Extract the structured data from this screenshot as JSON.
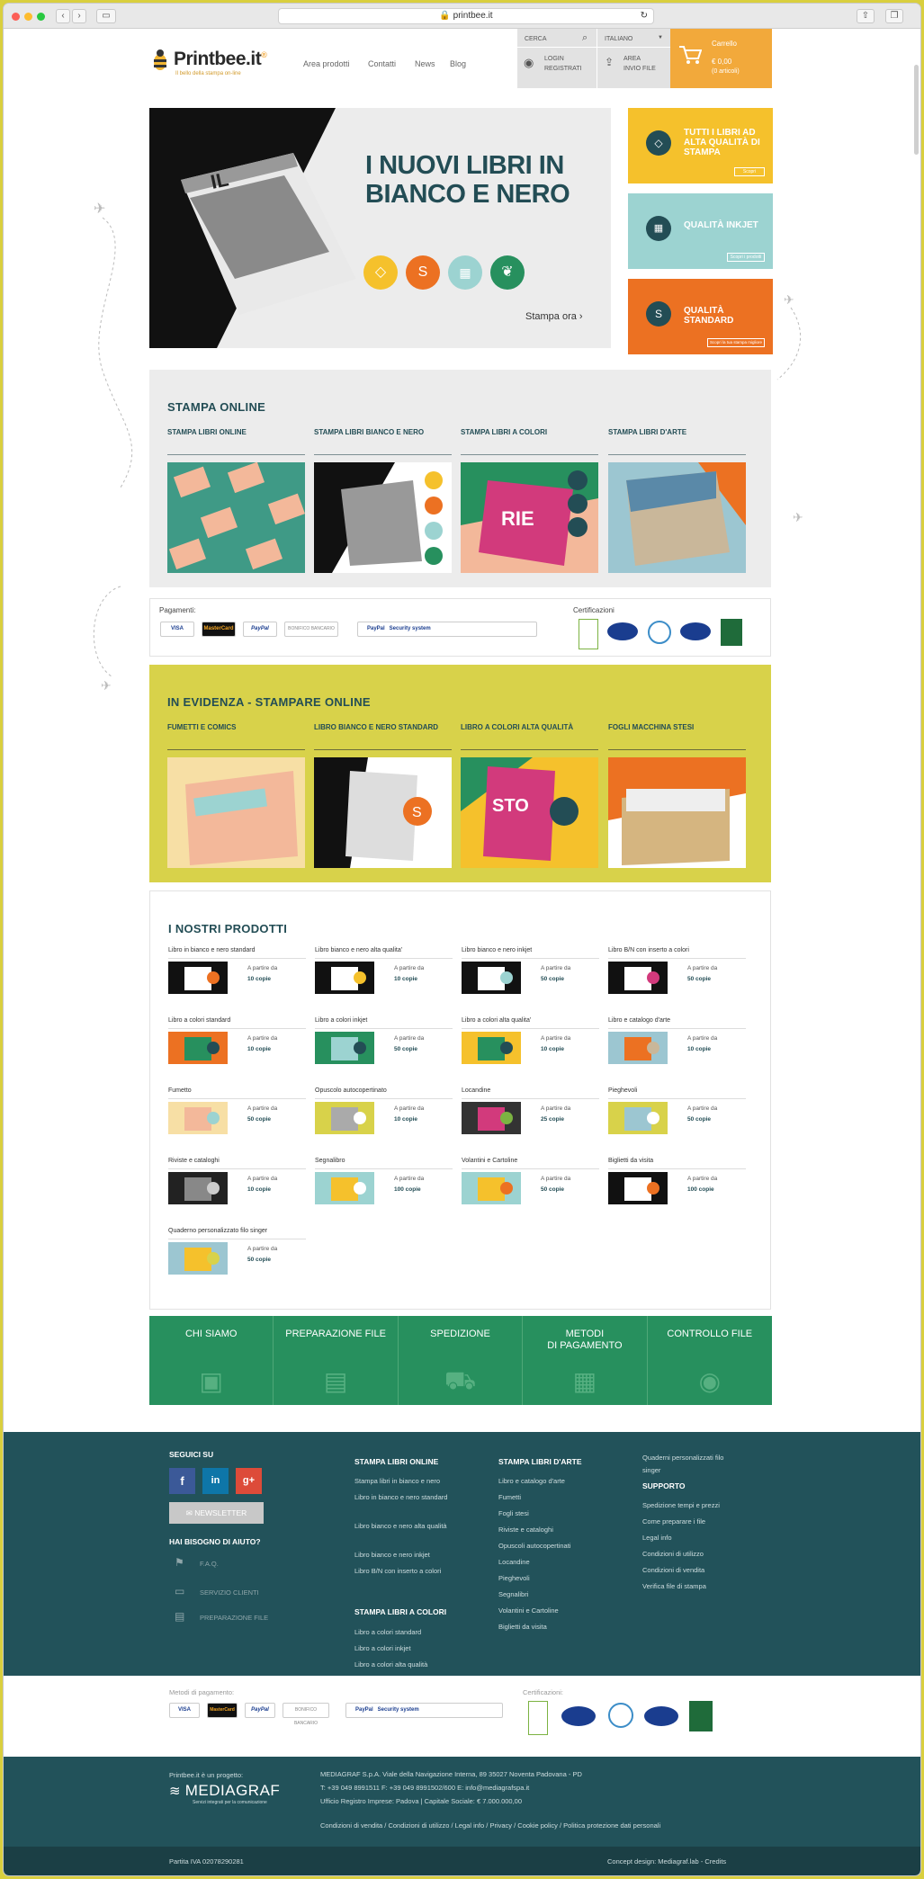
{
  "browser": {
    "url": "printbee.it"
  },
  "header": {
    "logo": "Printbee.it",
    "logo_reg": "®",
    "tagline": "Il bello della stampa on-line",
    "nav": [
      "Area prodotti",
      "Contatti",
      "News",
      "Blog"
    ],
    "search_label": "CERCA",
    "language": "ITALIANO",
    "login": "LOGIN\nREGISTRATI",
    "upload": "AREA\nINVIO FILE",
    "cart_title": "Carrello",
    "cart_amount": "€ 0,00",
    "cart_items": "(0 articoli)"
  },
  "hero": {
    "title": "I NUOVI LIBRI IN BIANCO E NERO",
    "cta": "Stampa ora ›",
    "icons": [
      "diamond-icon",
      "coin-icon",
      "inkjet-icon",
      "leaf-icon"
    ],
    "book_cover_text": "IL ... STORIE"
  },
  "categories": [
    {
      "title": "TUTTI I LIBRI AD ALTA QUALITÀ DI STAMPA",
      "button": "Scopri",
      "color": "#f5c12c"
    },
    {
      "title": "QUALITÀ INKJET",
      "button": "Scopri i prodotti",
      "color": "#9cd3d1"
    },
    {
      "title": "QUALITÀ STANDARD",
      "button": "Scopri la tua stampa migliore",
      "color": "#ec7122"
    }
  ],
  "stampa_online": {
    "title": "STAMPA ONLINE",
    "columns": [
      "STAMPA LIBRI ONLINE",
      "STAMPA LIBRI BIANCO E NERO",
      "STAMPA LIBRI A COLORI",
      "STAMPA LIBRI D'ARTE"
    ]
  },
  "payments": {
    "label": "Pagamenti:",
    "methods": [
      "VISA",
      "MasterCard",
      "PayPal",
      "BONIFICO BANCARIO"
    ],
    "paypal_security": "PayPal   Security system",
    "cert_label": "Certificazioni"
  },
  "evidenza": {
    "title": "IN EVIDENZA - STAMPARE ONLINE",
    "columns": [
      "FUMETTI E COMICS",
      "LIBRO BIANCO E NERO STANDARD",
      "LIBRO A COLORI ALTA QUALITÀ",
      "FOGLI MACCHINA STESI"
    ]
  },
  "prodotti": {
    "title": "I NOSTRI PRODOTTI",
    "from_label": "A partire da",
    "items": [
      {
        "name": "Libro in bianco e nero standard",
        "qty": "10 copie"
      },
      {
        "name": "Libro bianco e nero alta qualita'",
        "qty": "10 copie"
      },
      {
        "name": "Libro bianco e nero inkjet",
        "qty": "50 copie"
      },
      {
        "name": "Libro B/N con inserto a colori",
        "qty": "50 copie"
      },
      {
        "name": "Libro a colori standard",
        "qty": "10 copie"
      },
      {
        "name": "Libro a colori inkjet",
        "qty": "50 copie"
      },
      {
        "name": "Libro a colori alta qualita'",
        "qty": "10 copie"
      },
      {
        "name": "Libro e catalogo d'arte",
        "qty": "10 copie"
      },
      {
        "name": "Fumetto",
        "qty": "50 copie"
      },
      {
        "name": "Opuscolo autocopertinato",
        "qty": "10 copie"
      },
      {
        "name": "Locandine",
        "qty": "25 copie"
      },
      {
        "name": "Pieghevoli",
        "qty": "50 copie"
      },
      {
        "name": "Riviste e cataloghi",
        "qty": "10 copie"
      },
      {
        "name": "Segnalibro",
        "qty": "100 copie"
      },
      {
        "name": "Volantini e Cartoline",
        "qty": "50 copie"
      },
      {
        "name": "Biglietti da visita",
        "qty": "100 copie"
      },
      {
        "name": "Quaderno personalizzato filo singer",
        "qty": "50 copie"
      }
    ]
  },
  "info_bar": [
    {
      "label": "CHI SIAMO",
      "icon": "badge-icon"
    },
    {
      "label": "PREPARAZIONE FILE",
      "icon": "id-card-icon"
    },
    {
      "label": "SPEDIZIONE",
      "icon": "hand-truck-icon"
    },
    {
      "label": "METODI\nDI PAGAMENTO",
      "icon": "cash-icon"
    },
    {
      "label": "CONTROLLO FILE",
      "icon": "eye-icon"
    }
  ],
  "footer": {
    "follow": "SEGUICI SU",
    "social": [
      "f",
      "in",
      "g+"
    ],
    "newsletter": "NEWSLETTER",
    "help_title": "HAI BISOGNO DI AIUTO?",
    "help_items": [
      "F.A.Q.",
      "SERVIZIO CLIENTI",
      "PREPARAZIONE FILE"
    ],
    "col1_title": "STAMPA LIBRI ONLINE",
    "col1": [
      "Stampa libri in bianco e nero",
      "Libro in bianco e nero standard",
      "Libro bianco e nero alta qualità",
      "Libro bianco e nero inkjet",
      "Libro B/N con inserto a colori"
    ],
    "col1b_title": "STAMPA LIBRI A COLORI",
    "col1b": [
      "Libro a colori standard",
      "Libro a colori inkjet",
      "Libro a colori alta qualità"
    ],
    "col2_title": "STAMPA LIBRI D'ARTE",
    "col2": [
      "Libro e catalogo d'arte",
      "Fumetti",
      "Fogli stesi",
      "Riviste e cataloghi",
      "Opuscoli autocopertinati",
      "Locandine",
      "Pieghevoli",
      "Segnalibri",
      "Volantini e Cartoline",
      "Biglietti da visita"
    ],
    "col3_top": "Quaderni personalizzati filo singer",
    "col3_title": "SUPPORTO",
    "col3": [
      "Spedizione tempi e prezzi",
      "Come preparare i file",
      "Legal info",
      "Condizioni di utilizzo",
      "Condizioni di vendita",
      "Verifica file di stampa"
    ]
  },
  "pay_strip": {
    "label": "Metodi di pagamento:",
    "cert_label": "Certificazioni:"
  },
  "bottom": {
    "project": "Printbee.it è un progetto:",
    "company_logo": "MEDIAGRAF",
    "company_sub": "Servizi integrati per la comunicazione",
    "address": "MEDIAGRAF S.p.A. Viale della Navigazione Interna, 89 35027 Noventa Padovana - PD",
    "phones": "T: +39 049 8991511 F: +39 049 8991502/600 E: info@mediagrafspa.it",
    "registry": "Ufficio Registro Imprese: Padova | Capitale Sociale: € 7.000.000,00",
    "links": "Condizioni di vendita / Condizioni di utilizzo / Legal info / Privacy / Cookie policy / Politica protezione dati personali",
    "vat": "Partita IVA 02078290281",
    "credits": "Concept design: Mediagraf.lab - Credits"
  },
  "colors": {
    "teal": "#234d55",
    "green": "#27905e",
    "yellow": "#d8d24a",
    "orange": "#f2a93b"
  }
}
